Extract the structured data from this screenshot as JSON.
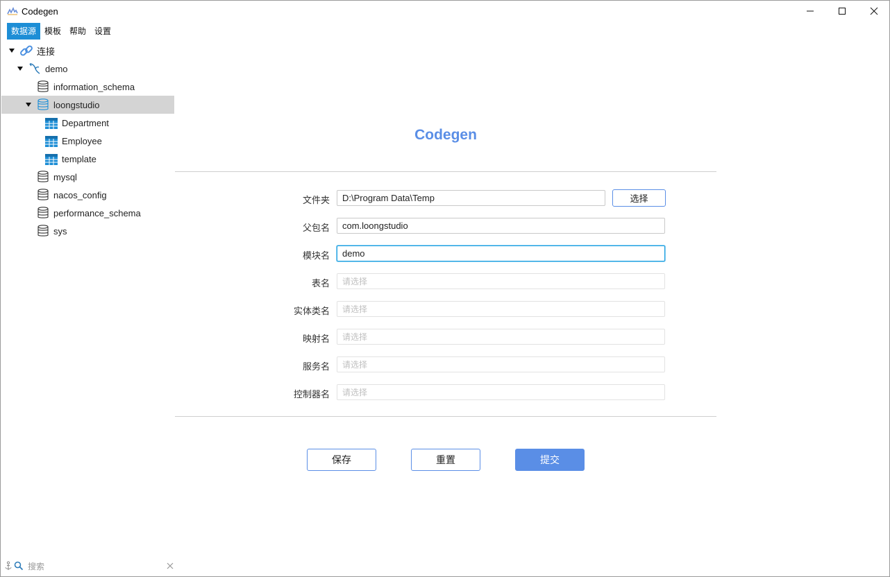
{
  "window": {
    "title": "Codegen"
  },
  "menu": {
    "items": [
      "数据源",
      "模板",
      "帮助",
      "设置"
    ],
    "active_index": 0
  },
  "tree": {
    "root": "连接",
    "connection": "demo",
    "databases": {
      "information_schema": "information_schema",
      "loongstudio": "loongstudio",
      "mysql": "mysql",
      "nacos_config": "nacos_config",
      "performance_schema": "performance_schema",
      "sys": "sys"
    },
    "tables": [
      "Department",
      "Employee",
      "template"
    ],
    "selected": "loongstudio"
  },
  "search": {
    "placeholder": "搜索"
  },
  "form": {
    "title": "Codegen",
    "folder": {
      "label": "文件夹",
      "value": "D:\\Program Data\\Temp",
      "button": "选择"
    },
    "package": {
      "label": "父包名",
      "value": "com.loongstudio"
    },
    "module": {
      "label": "模块名",
      "value": "demo"
    },
    "table": {
      "label": "表名",
      "placeholder": "请选择"
    },
    "entity": {
      "label": "实体类名",
      "placeholder": "请选择"
    },
    "mapper": {
      "label": "映射名",
      "placeholder": "请选择"
    },
    "service": {
      "label": "服务名",
      "placeholder": "请选择"
    },
    "controller": {
      "label": "控制器名",
      "placeholder": "请选择"
    }
  },
  "actions": {
    "save": "保存",
    "reset": "重置",
    "submit": "提交"
  },
  "colors": {
    "accent": "#5a8ee6",
    "menu_active": "#1d8ed6",
    "table_icon": "#1d8ed6",
    "selected_row": "#d4d4d4"
  },
  "icons": [
    "app-logo-icon",
    "minimize-icon",
    "maximize-icon",
    "close-icon",
    "link-icon",
    "mysql-dolphin-icon",
    "database-icon",
    "table-icon",
    "anchor-icon",
    "search-icon",
    "clear-icon"
  ]
}
